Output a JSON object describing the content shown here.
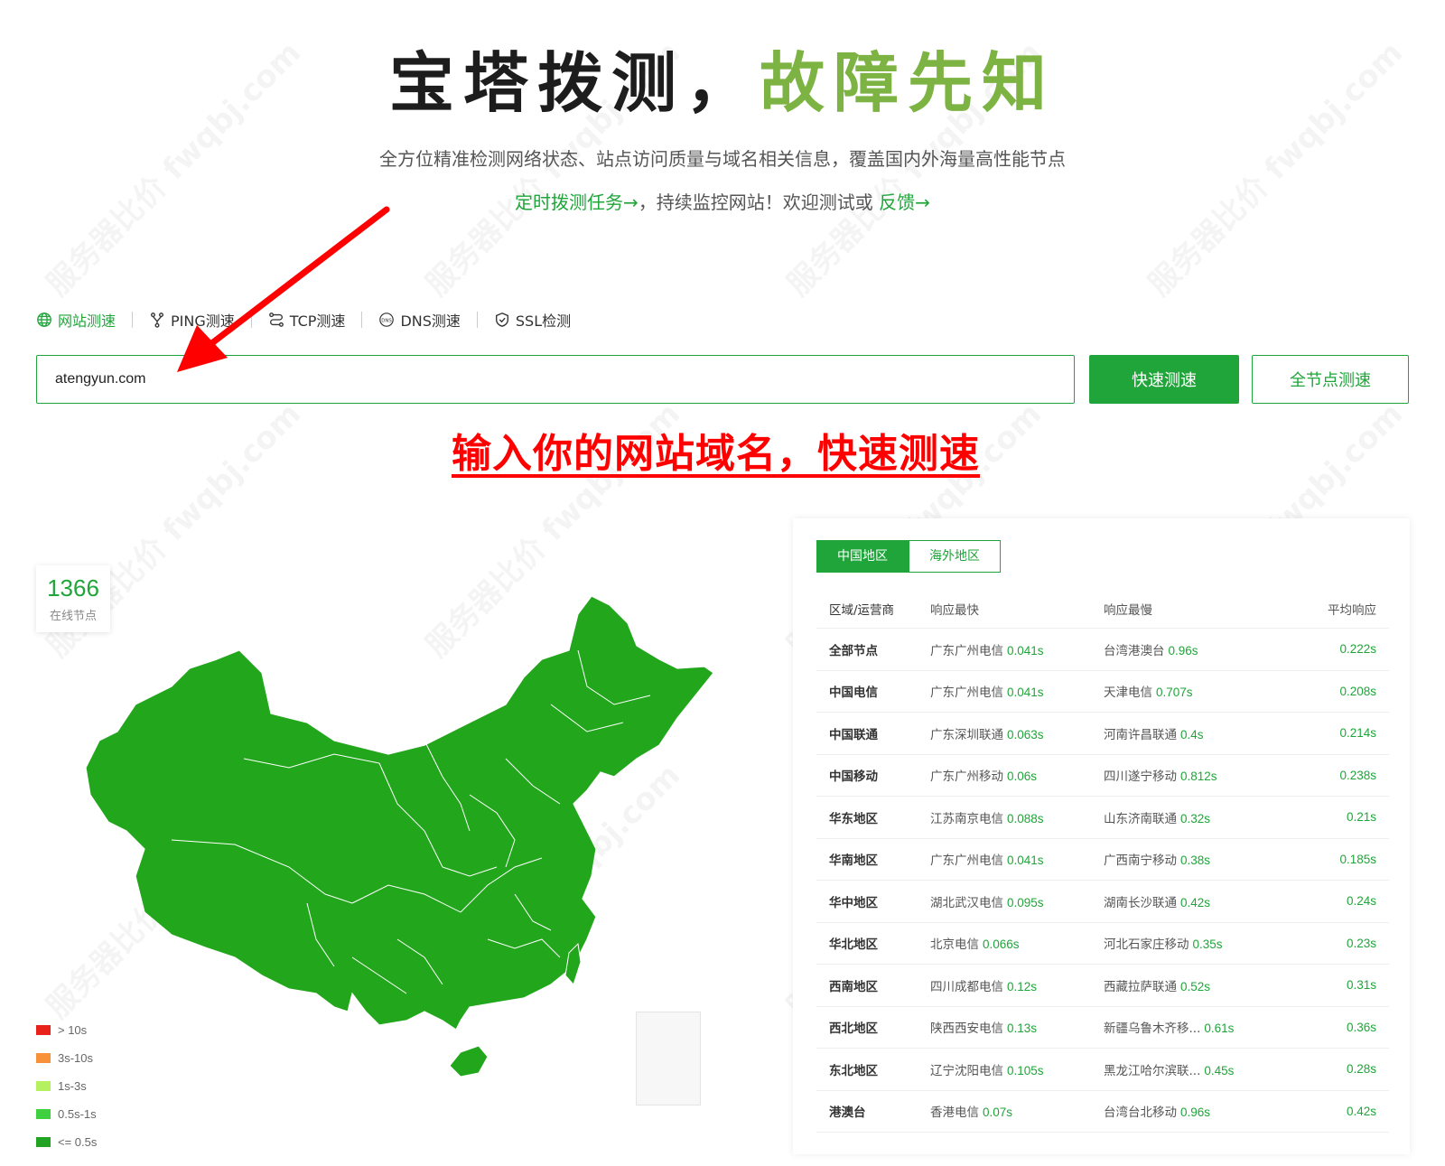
{
  "hero": {
    "title_dark": "宝塔拨测，",
    "title_green": "故障先知",
    "subtitle": "全方位精准检测网络状态、站点访问质量与域名相关信息，覆盖国内外海量高性能节点",
    "cta_link1": "定时拨测任务→",
    "cta_mid": "，持续监控网站！欢迎测试或 ",
    "cta_link2": "反馈→"
  },
  "tabs": [
    {
      "label": "网站测速",
      "icon": "globe-icon",
      "active": true
    },
    {
      "label": "PING测速",
      "icon": "fork-icon",
      "active": false
    },
    {
      "label": "TCP测速",
      "icon": "route-icon",
      "active": false
    },
    {
      "label": "DNS测速",
      "icon": "dns-icon",
      "active": false
    },
    {
      "label": "SSL检测",
      "icon": "shield-icon",
      "active": false
    }
  ],
  "search": {
    "value": "atengyun.com"
  },
  "buttons": {
    "quick": "快速测速",
    "all_nodes": "全节点测速"
  },
  "annotation": "输入你的网站域名，快速测速",
  "stats": {
    "online_count": "1366",
    "online_label": "在线节点"
  },
  "legend": [
    {
      "label": "> 10s",
      "color": "#e8211a"
    },
    {
      "label": "3s-10s",
      "color": "#f7923a"
    },
    {
      "label": "1s-3s",
      "color": "#b5f05e"
    },
    {
      "label": "0.5s-1s",
      "color": "#3fd03f"
    },
    {
      "label": "<= 0.5s",
      "color": "#22a322"
    }
  ],
  "map_color": "#22a61c",
  "region_tabs": {
    "china": "中国地区",
    "overseas": "海外地区"
  },
  "table": {
    "headers": [
      "区域/运营商",
      "响应最快",
      "响应最慢",
      "平均响应"
    ],
    "rows": [
      {
        "region": "全部节点",
        "fast_name": "广东广州电信",
        "fast_val": "0.041s",
        "slow_name": "台湾港澳台",
        "slow_val": "0.96s",
        "avg": "0.222s"
      },
      {
        "region": "中国电信",
        "fast_name": "广东广州电信",
        "fast_val": "0.041s",
        "slow_name": "天津电信",
        "slow_val": "0.707s",
        "avg": "0.208s"
      },
      {
        "region": "中国联通",
        "fast_name": "广东深圳联通",
        "fast_val": "0.063s",
        "slow_name": "河南许昌联通",
        "slow_val": "0.4s",
        "avg": "0.214s"
      },
      {
        "region": "中国移动",
        "fast_name": "广东广州移动",
        "fast_val": "0.06s",
        "slow_name": "四川遂宁移动",
        "slow_val": "0.812s",
        "avg": "0.238s"
      },
      {
        "region": "华东地区",
        "fast_name": "江苏南京电信",
        "fast_val": "0.088s",
        "slow_name": "山东济南联通",
        "slow_val": "0.32s",
        "avg": "0.21s"
      },
      {
        "region": "华南地区",
        "fast_name": "广东广州电信",
        "fast_val": "0.041s",
        "slow_name": "广西南宁移动",
        "slow_val": "0.38s",
        "avg": "0.185s"
      },
      {
        "region": "华中地区",
        "fast_name": "湖北武汉电信",
        "fast_val": "0.095s",
        "slow_name": "湖南长沙联通",
        "slow_val": "0.42s",
        "avg": "0.24s"
      },
      {
        "region": "华北地区",
        "fast_name": "北京电信",
        "fast_val": "0.066s",
        "slow_name": "河北石家庄移动",
        "slow_val": "0.35s",
        "avg": "0.23s"
      },
      {
        "region": "西南地区",
        "fast_name": "四川成都电信",
        "fast_val": "0.12s",
        "slow_name": "西藏拉萨联通",
        "slow_val": "0.52s",
        "avg": "0.31s"
      },
      {
        "region": "西北地区",
        "fast_name": "陕西西安电信",
        "fast_val": "0.13s",
        "slow_name": "新疆乌鲁木齐移...",
        "slow_val": "0.61s",
        "avg": "0.36s"
      },
      {
        "region": "东北地区",
        "fast_name": "辽宁沈阳电信",
        "fast_val": "0.105s",
        "slow_name": "黑龙江哈尔滨联...",
        "slow_val": "0.45s",
        "avg": "0.28s"
      },
      {
        "region": "港澳台",
        "fast_name": "香港电信",
        "fast_val": "0.07s",
        "slow_name": "台湾台北移动",
        "slow_val": "0.96s",
        "avg": "0.42s"
      }
    ]
  },
  "watermark": "服务器比价 fwqbj.com"
}
